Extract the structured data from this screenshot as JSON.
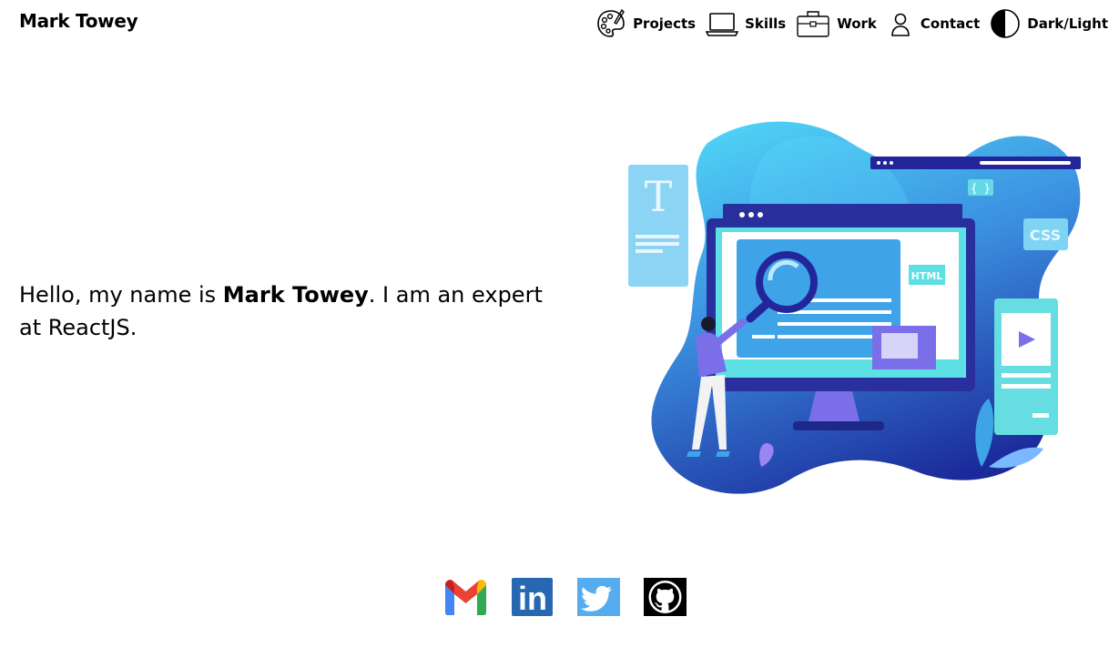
{
  "brand": {
    "name": "Mark Towey"
  },
  "nav": {
    "items": [
      {
        "label": "Projects",
        "icon": "palette-icon"
      },
      {
        "label": "Skills",
        "icon": "laptop-icon"
      },
      {
        "label": "Work",
        "icon": "briefcase-icon"
      },
      {
        "label": "Contact",
        "icon": "person-icon"
      },
      {
        "label": "Dark/Light",
        "icon": "contrast-icon"
      }
    ]
  },
  "hero": {
    "greeting": "Hello, my name is ",
    "name": "Mark Towey",
    "rest": ". I am an expert at ReactJS."
  },
  "illustration": {
    "labels": {
      "html": "HTML",
      "css": "CSS",
      "braces": "{ }",
      "letter": "T"
    }
  },
  "socials": [
    {
      "icon": "gmail-icon"
    },
    {
      "icon": "linkedin-icon",
      "text": "in"
    },
    {
      "icon": "twitter-icon"
    },
    {
      "icon": "github-icon"
    }
  ],
  "colors": {
    "text": "#000000",
    "background": "#ffffff",
    "blob_light": "#4fc8f0",
    "blob_dark": "#1e2d9e",
    "gmail_red": "#ea4335",
    "gmail_blue": "#4285f4",
    "gmail_green": "#34a853",
    "gmail_yellow": "#fbbc05",
    "linkedin": "#2867b2",
    "twitter": "#55acee",
    "github": "#000000"
  }
}
